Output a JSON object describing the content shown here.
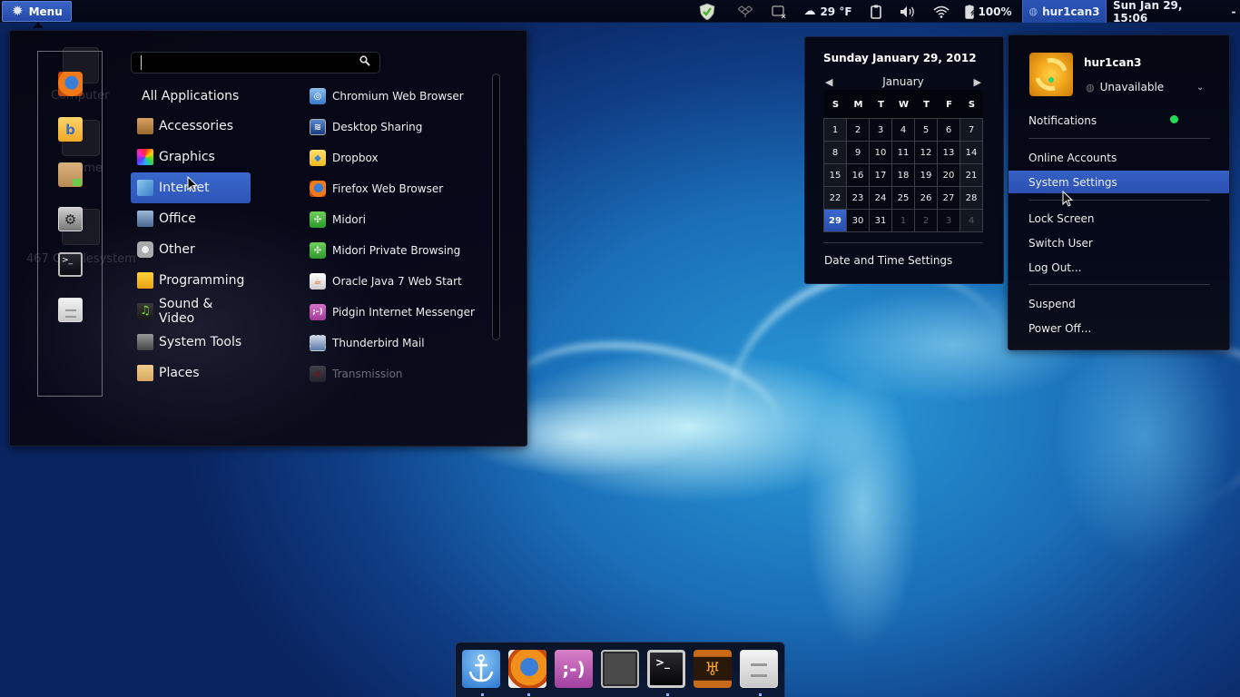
{
  "top_panel": {
    "menu_label": "Menu",
    "weather": "29 °F",
    "battery": "100%",
    "user": "hur1can3",
    "clock": "Sun Jan 29, 15:06"
  },
  "desktop": {
    "icons": [
      "Computer",
      "Home",
      "467 GB Filesystem"
    ]
  },
  "main_menu": {
    "search": {
      "value": "",
      "placeholder": ""
    },
    "favorites": [
      "Firefox Web Browser",
      "Banshee",
      "Package Manager",
      "System Settings",
      "Terminal",
      "Files"
    ],
    "categories": [
      {
        "label": "All Applications",
        "icon": "none"
      },
      {
        "label": "Accessories",
        "icon": "calculator-icon"
      },
      {
        "label": "Graphics",
        "icon": "color-palette-icon"
      },
      {
        "label": "Internet",
        "icon": "globe-icon",
        "selected": true
      },
      {
        "label": "Office",
        "icon": "chart-icon"
      },
      {
        "label": "Other",
        "icon": "gear-icon"
      },
      {
        "label": "Programming",
        "icon": "construction-icon"
      },
      {
        "label": "Sound & Video",
        "icon": "music-icon"
      },
      {
        "label": "System Tools",
        "icon": "tools-icon"
      },
      {
        "label": "Places",
        "icon": "folder-icon"
      }
    ],
    "apps": [
      {
        "label": "Chromium Web Browser"
      },
      {
        "label": "Desktop Sharing"
      },
      {
        "label": "Dropbox"
      },
      {
        "label": "Firefox Web Browser"
      },
      {
        "label": "Midori"
      },
      {
        "label": "Midori Private Browsing"
      },
      {
        "label": "Oracle Java 7 Web Start"
      },
      {
        "label": "Pidgin Internet Messenger"
      },
      {
        "label": "Thunderbird Mail"
      },
      {
        "label": "Transmission",
        "disabled": true
      }
    ]
  },
  "calendar": {
    "title": "Sunday January 29, 2012",
    "month": "January",
    "weekdays": [
      "S",
      "M",
      "T",
      "W",
      "T",
      "F",
      "S"
    ],
    "weeks": [
      [
        "1",
        "2",
        "3",
        "4",
        "5",
        "6",
        "7"
      ],
      [
        "8",
        "9",
        "10",
        "11",
        "12",
        "13",
        "14"
      ],
      [
        "15",
        "16",
        "17",
        "18",
        "19",
        "20",
        "21"
      ],
      [
        "22",
        "23",
        "24",
        "25",
        "26",
        "27",
        "28"
      ],
      [
        "29",
        "30",
        "31",
        "1",
        "2",
        "3",
        "4"
      ]
    ],
    "today": "29",
    "settings_label": "Date and Time Settings"
  },
  "user_menu": {
    "name": "hur1can3",
    "status": "Unavailable",
    "notifications": "Notifications",
    "notifications_color": "#22dd55",
    "items": {
      "online_accounts": "Online Accounts",
      "system_settings": "System Settings",
      "lock_screen": "Lock Screen",
      "switch_user": "Switch User",
      "log_out": "Log Out...",
      "suspend": "Suspend",
      "power_off": "Power Off..."
    }
  },
  "dock": {
    "items": [
      "Docky",
      "Firefox Web Browser",
      "Pidgin Internet Messenger",
      "Window",
      "Terminal",
      "Music Player",
      "Files"
    ],
    "running": [
      true,
      true,
      false,
      false,
      true,
      false,
      true
    ]
  },
  "colors": {
    "accent": "#2d55b8",
    "panel": "#05091a"
  }
}
